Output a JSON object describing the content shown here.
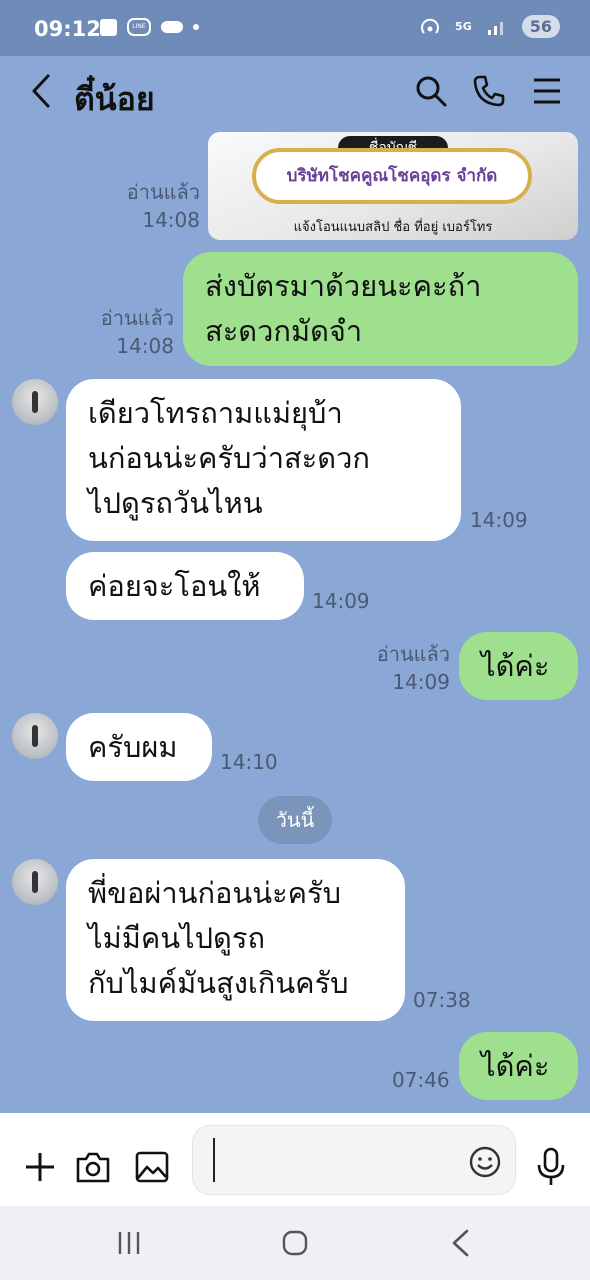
{
  "status": {
    "time": "09:12",
    "network": "5G",
    "battery": "56"
  },
  "header": {
    "title": "ตี๋น้อย"
  },
  "image_message": {
    "tag": "ชื่อบัญชี",
    "company": "บริษัทโชคคูณโชคอุดร จำกัด",
    "subtitle": "แจ้งโอนแนบสลิป ชื่อ ที่อยู่ เบอร์โทร",
    "read": "อ่านแล้ว",
    "time": "14:08"
  },
  "messages": [
    {
      "text": "ส่งบัตรมาด้วยนะคะถ้า\nสะดวกมัดจำ",
      "read": "อ่านแล้ว",
      "time": "14:08"
    },
    {
      "text": "เดียวโทรถามแม่ยุบ้า\nนก่อนน่ะครับว่าสะดวก\nไปดูรถวันไหน",
      "time": "14:09"
    },
    {
      "text": "ค่อยจะโอนให้",
      "time": "14:09"
    },
    {
      "text": "ได้ค่ะ",
      "read": "อ่านแล้ว",
      "time": "14:09"
    },
    {
      "text": "ครับผม",
      "time": "14:10"
    },
    {
      "text": "พี่ขอผ่านก่อนน่ะครับ\nไม่มีคนไปดูรถ\nกับไมค์มันสูงเกินครับ",
      "time": "07:38"
    },
    {
      "text": "ได้ค่ะ",
      "time": "07:46"
    }
  ],
  "date_separator": "วันนี้",
  "icons": {
    "back": "chevron-left-icon",
    "search": "search-icon",
    "call": "phone-icon",
    "menu": "menu-icon",
    "add": "plus-icon",
    "camera": "camera-icon",
    "gallery": "image-icon",
    "emoji": "emoji-icon",
    "mic": "mic-icon"
  },
  "colors": {
    "background": "#8aa7d6",
    "incoming_bubble": "#ffffff",
    "outgoing_bubble": "#9ee08d"
  }
}
